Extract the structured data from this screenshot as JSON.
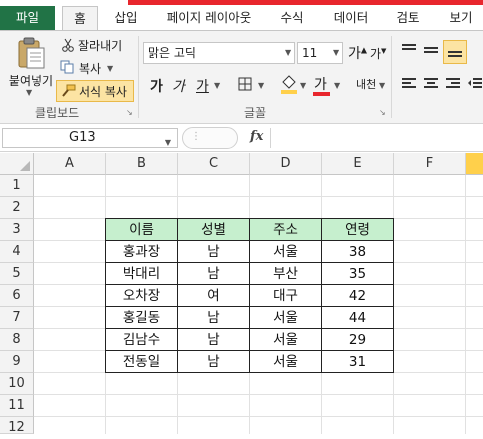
{
  "ribbon": {
    "tabs": [
      "파일",
      "홈",
      "삽입",
      "페이지 레이아웃",
      "수식",
      "데이터",
      "검토",
      "보기"
    ],
    "clipboard": {
      "paste_label": "붙여넣기",
      "cut_label": "잘라내기",
      "copy_label": "복사",
      "format_painter_label": "서식 복사",
      "group_label": "클립보드"
    },
    "font": {
      "font_name": "맑은 고딕",
      "font_size": "11",
      "grow_font": "가",
      "shrink_font": "가",
      "bold": "가",
      "italic": "가",
      "underline": "가",
      "font_color_glyph": "가",
      "phonetic_glyph": "내천",
      "group_label": "글꼴"
    }
  },
  "formula_bar": {
    "name_box": "G13",
    "fx_label": "fx",
    "formula": ""
  },
  "sheet": {
    "columns": [
      "A",
      "B",
      "C",
      "D",
      "E",
      "F"
    ],
    "rows": [
      "1",
      "2",
      "3",
      "4",
      "5",
      "6",
      "7",
      "8",
      "9",
      "10",
      "11",
      "12"
    ],
    "table": {
      "headers": [
        "이름",
        "성별",
        "주소",
        "연령"
      ],
      "rows": [
        [
          "홍과장",
          "남",
          "서울",
          "38"
        ],
        [
          "박대리",
          "남",
          "부산",
          "35"
        ],
        [
          "오차장",
          "여",
          "대구",
          "42"
        ],
        [
          "홍길동",
          "남",
          "서울",
          "44"
        ],
        [
          "김남수",
          "남",
          "서울",
          "29"
        ],
        [
          "전동일",
          "남",
          "서울",
          "31"
        ]
      ]
    }
  },
  "colors": {
    "accent": "#217346",
    "header_fill": "#c6efce",
    "highlight": "#ffd04b",
    "font_color": "#e8262d"
  }
}
